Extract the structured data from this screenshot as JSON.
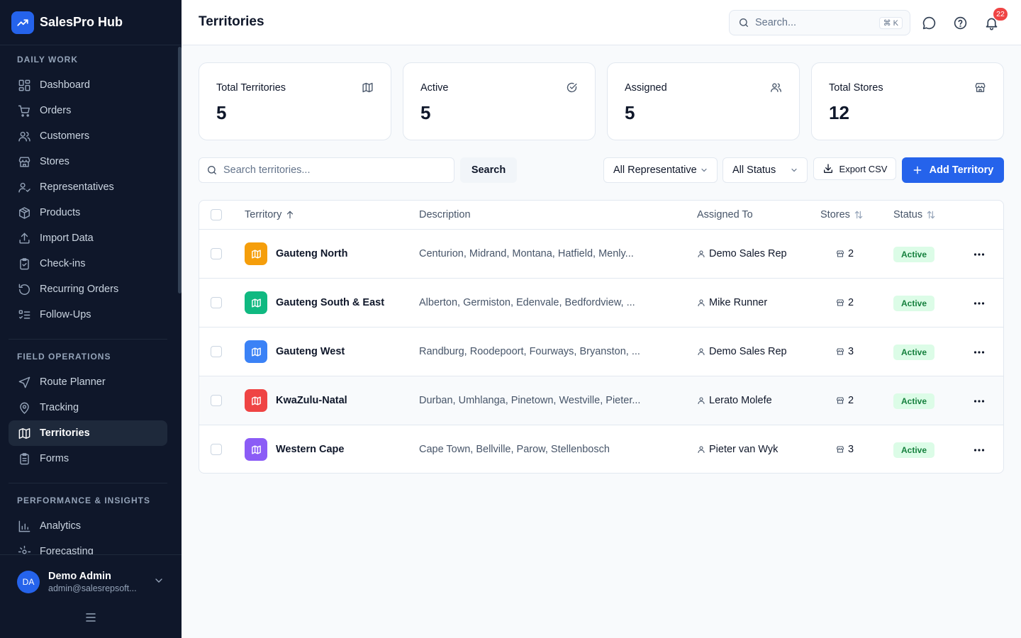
{
  "app": {
    "name": "SalesPro Hub"
  },
  "sidebar": {
    "sections": [
      {
        "title": "DAILY WORK",
        "items": [
          {
            "label": "Dashboard",
            "icon": "dashboard-icon"
          },
          {
            "label": "Orders",
            "icon": "cart-icon"
          },
          {
            "label": "Customers",
            "icon": "users-icon"
          },
          {
            "label": "Stores",
            "icon": "store-icon"
          },
          {
            "label": "Representatives",
            "icon": "user-check-icon"
          },
          {
            "label": "Products",
            "icon": "package-icon"
          },
          {
            "label": "Import Data",
            "icon": "upload-icon"
          },
          {
            "label": "Check-ins",
            "icon": "clipboard-check-icon"
          },
          {
            "label": "Recurring Orders",
            "icon": "rotate-icon"
          },
          {
            "label": "Follow-Ups",
            "icon": "list-check-icon"
          }
        ]
      },
      {
        "title": "FIELD OPERATIONS",
        "items": [
          {
            "label": "Route Planner",
            "icon": "navigation-icon"
          },
          {
            "label": "Tracking",
            "icon": "map-pin-icon"
          },
          {
            "label": "Territories",
            "icon": "map-icon",
            "active": true
          },
          {
            "label": "Forms",
            "icon": "form-icon"
          }
        ]
      },
      {
        "title": "PERFORMANCE & INSIGHTS",
        "items": [
          {
            "label": "Analytics",
            "icon": "bar-chart-icon"
          },
          {
            "label": "Forecasting",
            "icon": "forecast-icon"
          }
        ]
      }
    ],
    "user": {
      "initials": "DA",
      "name": "Demo Admin",
      "email": "admin@salesrepsoft..."
    }
  },
  "header": {
    "title": "Territories",
    "search_placeholder": "Search...",
    "shortcut": "⌘ K",
    "notification_count": "22"
  },
  "stats": [
    {
      "label": "Total Territories",
      "value": "5",
      "icon": "map-icon"
    },
    {
      "label": "Active",
      "value": "5",
      "icon": "check-circle-icon"
    },
    {
      "label": "Assigned",
      "value": "5",
      "icon": "users-icon"
    },
    {
      "label": "Total Stores",
      "value": "12",
      "icon": "store-icon"
    }
  ],
  "toolbar": {
    "search_placeholder": "Search territories...",
    "search_button": "Search",
    "rep_filter": "All Representative",
    "status_filter": "All Status",
    "export_label": "Export CSV",
    "add_label": "Add Territory"
  },
  "table": {
    "columns": {
      "territory": "Territory",
      "description": "Description",
      "assigned": "Assigned To",
      "stores": "Stores",
      "status": "Status"
    },
    "rows": [
      {
        "name": "Gauteng North",
        "description": "Centurion, Midrand, Montana, Hatfield, Menly...",
        "assigned": "Demo Sales Rep",
        "stores": "2",
        "status": "Active",
        "color": "#f59e0b"
      },
      {
        "name": "Gauteng South & East",
        "description": "Alberton, Germiston, Edenvale, Bedfordview, ...",
        "assigned": "Mike Runner",
        "stores": "2",
        "status": "Active",
        "color": "#10b981"
      },
      {
        "name": "Gauteng West",
        "description": "Randburg, Roodepoort, Fourways, Bryanston, ...",
        "assigned": "Demo Sales Rep",
        "stores": "3",
        "status": "Active",
        "color": "#3b82f6"
      },
      {
        "name": "KwaZulu-Natal",
        "description": "Durban, Umhlanga, Pinetown, Westville, Pieter...",
        "assigned": "Lerato Molefe",
        "stores": "2",
        "status": "Active",
        "color": "#ef4444"
      },
      {
        "name": "Western Cape",
        "description": "Cape Town, Bellville, Parow, Stellenbosch",
        "assigned": "Pieter van Wyk",
        "stores": "3",
        "status": "Active",
        "color": "#8b5cf6"
      }
    ]
  },
  "colors": {
    "accent": "#2563eb",
    "sidebar_bg": "#0f172a",
    "active_badge_bg": "#dcfce7",
    "active_badge_text": "#15803d"
  }
}
